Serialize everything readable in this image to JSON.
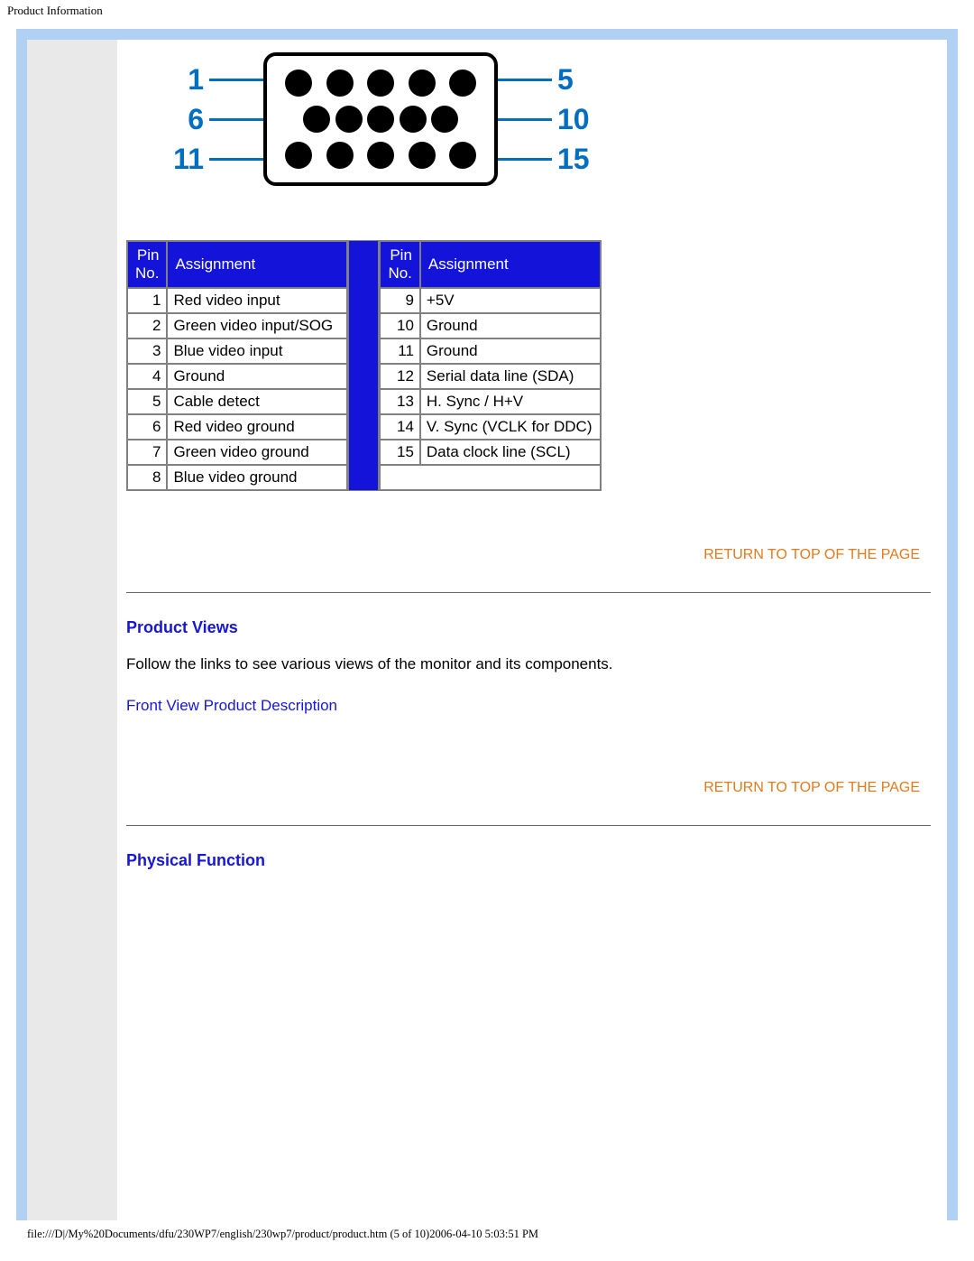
{
  "page_header": "Product Information",
  "connector": {
    "rows": [
      {
        "left": "1",
        "right": "5"
      },
      {
        "left": "6",
        "right": "10"
      },
      {
        "left": "11",
        "right": "15"
      }
    ]
  },
  "pin_table_headers": {
    "pin": "Pin No.",
    "assign": "Assignment"
  },
  "pins_left": [
    {
      "no": "1",
      "assign": "Red video input"
    },
    {
      "no": "2",
      "assign": "Green video input/SOG"
    },
    {
      "no": "3",
      "assign": "Blue video input"
    },
    {
      "no": "4",
      "assign": "Ground"
    },
    {
      "no": "5",
      "assign": "Cable detect"
    },
    {
      "no": "6",
      "assign": "Red video ground"
    },
    {
      "no": "7",
      "assign": "Green video ground"
    },
    {
      "no": "8",
      "assign": "Blue video ground"
    }
  ],
  "pins_right": [
    {
      "no": "9",
      "assign": "+5V"
    },
    {
      "no": "10",
      "assign": "Ground"
    },
    {
      "no": "11",
      "assign": "Ground"
    },
    {
      "no": "12",
      "assign": "Serial data line (SDA)"
    },
    {
      "no": "13",
      "assign": "H. Sync / H+V"
    },
    {
      "no": "14",
      "assign": "V. Sync (VCLK for DDC)"
    },
    {
      "no": "15",
      "assign": "Data clock line (SCL)"
    }
  ],
  "return_link": "RETURN TO TOP OF THE PAGE",
  "section_product_views": {
    "heading": "Product Views",
    "body": "Follow the links to see various views of the monitor and its components.",
    "link": "Front View Product Description"
  },
  "section_physical_function": {
    "heading": "Physical Function"
  },
  "footer_path": "file:///D|/My%20Documents/dfu/230WP7/english/230wp7/product/product.htm (5 of 10)2006-04-10 5:03:51 PM"
}
